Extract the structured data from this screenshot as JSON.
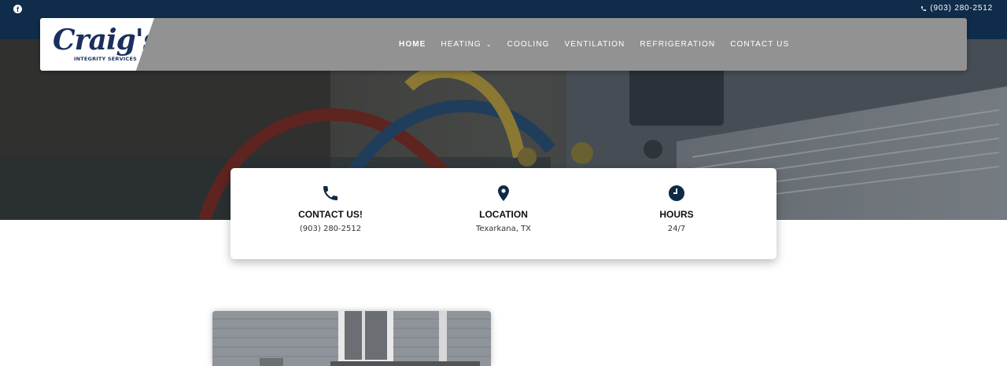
{
  "topbar": {
    "social_icon": "facebook-icon",
    "phone_icon": "phone-icon",
    "phone": "(903) 280-2512"
  },
  "logo": {
    "script": "Craig's",
    "tagline": "INTEGRITY SERVICES"
  },
  "nav": {
    "items": [
      {
        "label": "HOME",
        "active": true
      },
      {
        "label": "HEATING",
        "has_dropdown": true
      },
      {
        "label": "COOLING"
      },
      {
        "label": "VENTILATION"
      },
      {
        "label": "REFRIGERATION"
      },
      {
        "label": "CONTACT US"
      }
    ]
  },
  "info_cards": [
    {
      "icon": "phone-icon",
      "title": "CONTACT US!",
      "text": "(903) 280-2512"
    },
    {
      "icon": "map-pin-icon",
      "title": "LOCATION",
      "text": "Texarkana, TX"
    },
    {
      "icon": "clock-icon",
      "title": "HOURS",
      "text": "24/7"
    }
  ],
  "colors": {
    "topbar": "#0f2c4a",
    "navbar": "#929292",
    "logo_ink": "#1b2f5e",
    "icon": "#0f2a44"
  }
}
